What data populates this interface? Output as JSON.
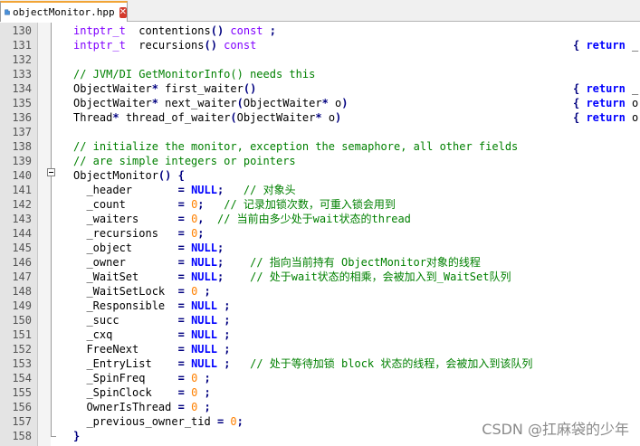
{
  "tab": {
    "title": "objectMonitor.hpp",
    "close": "✕"
  },
  "watermark": "CSDN @扛麻袋的少年",
  "lines": [
    {
      "n": "130",
      "code": [
        [
          "ty",
          "intptr_t"
        ],
        [
          "",
          "  contentions"
        ],
        [
          "op",
          "()"
        ],
        [
          "",
          ""
        ],
        [
          "kw",
          " const"
        ],
        [
          "",
          " "
        ],
        [
          "op",
          ";"
        ]
      ],
      "right": []
    },
    {
      "n": "131",
      "code": [
        [
          "ty",
          "intptr_t"
        ],
        [
          "",
          "  recursions"
        ],
        [
          "op",
          "()"
        ],
        [
          "kw",
          " const"
        ]
      ],
      "right": [
        [
          "op",
          "{"
        ],
        [
          "kb",
          " return"
        ],
        [
          "",
          " _"
        ]
      ]
    },
    {
      "n": "132",
      "code": [],
      "right": []
    },
    {
      "n": "133",
      "code": [
        [
          "cm",
          "// JVM/DI GetMonitorInfo() needs this"
        ]
      ],
      "right": []
    },
    {
      "n": "134",
      "code": [
        [
          "",
          "ObjectWaiter"
        ],
        [
          "op",
          "*"
        ],
        [
          "",
          " first_waiter"
        ],
        [
          "op",
          "()"
        ]
      ],
      "right": [
        [
          "op",
          "{"
        ],
        [
          "kb",
          " return"
        ],
        [
          "",
          " _"
        ]
      ]
    },
    {
      "n": "135",
      "code": [
        [
          "",
          "ObjectWaiter"
        ],
        [
          "op",
          "*"
        ],
        [
          "",
          " next_waiter"
        ],
        [
          "op",
          "("
        ],
        [
          "",
          "ObjectWaiter"
        ],
        [
          "op",
          "*"
        ],
        [
          "",
          " o"
        ],
        [
          "op",
          ")"
        ]
      ],
      "right": [
        [
          "op",
          "{"
        ],
        [
          "kb",
          " return"
        ],
        [
          "",
          " o"
        ]
      ]
    },
    {
      "n": "136",
      "code": [
        [
          "",
          "Thread"
        ],
        [
          "op",
          "*"
        ],
        [
          "",
          " thread_of_waiter"
        ],
        [
          "op",
          "("
        ],
        [
          "",
          "ObjectWaiter"
        ],
        [
          "op",
          "*"
        ],
        [
          "",
          " o"
        ],
        [
          "op",
          ")"
        ]
      ],
      "right": [
        [
          "op",
          "{"
        ],
        [
          "kb",
          " return"
        ],
        [
          "",
          " o"
        ]
      ]
    },
    {
      "n": "137",
      "code": [],
      "right": []
    },
    {
      "n": "138",
      "code": [
        [
          "cm",
          "// initialize the monitor, exception the semaphore, all other fields"
        ]
      ],
      "right": []
    },
    {
      "n": "139",
      "code": [
        [
          "cm",
          "// are simple integers or pointers"
        ]
      ],
      "right": []
    },
    {
      "n": "140",
      "code": [
        [
          "",
          "ObjectMonitor"
        ],
        [
          "op",
          "()"
        ],
        [
          "",
          " "
        ],
        [
          "op",
          "{"
        ]
      ],
      "right": []
    },
    {
      "n": "141",
      "code": [
        [
          "",
          "  _header       "
        ],
        [
          "op",
          "="
        ],
        [
          "",
          " "
        ],
        [
          "kb",
          "NULL"
        ],
        [
          "op",
          ";"
        ],
        [
          "",
          "   "
        ],
        [
          "cm",
          "// 对象头"
        ]
      ],
      "right": []
    },
    {
      "n": "142",
      "code": [
        [
          "",
          "  _count        "
        ],
        [
          "op",
          "="
        ],
        [
          "",
          " "
        ],
        [
          "num",
          "0"
        ],
        [
          "op",
          ";"
        ],
        [
          "",
          "   "
        ],
        [
          "cm",
          "// 记录加锁次数，可重入锁会用到"
        ]
      ],
      "right": []
    },
    {
      "n": "143",
      "code": [
        [
          "",
          "  _waiters      "
        ],
        [
          "op",
          "="
        ],
        [
          "",
          " "
        ],
        [
          "num",
          "0"
        ],
        [
          "op",
          ","
        ],
        [
          "",
          "  "
        ],
        [
          "cm",
          "// 当前由多少处于wait状态的thread"
        ]
      ],
      "right": []
    },
    {
      "n": "144",
      "code": [
        [
          "",
          "  _recursions   "
        ],
        [
          "op",
          "="
        ],
        [
          "",
          " "
        ],
        [
          "num",
          "0"
        ],
        [
          "op",
          ";"
        ]
      ],
      "right": []
    },
    {
      "n": "145",
      "code": [
        [
          "",
          "  _object       "
        ],
        [
          "op",
          "="
        ],
        [
          "",
          " "
        ],
        [
          "kb",
          "NULL"
        ],
        [
          "op",
          ";"
        ]
      ],
      "right": []
    },
    {
      "n": "146",
      "code": [
        [
          "",
          "  _owner        "
        ],
        [
          "op",
          "="
        ],
        [
          "",
          " "
        ],
        [
          "kb",
          "NULL"
        ],
        [
          "op",
          ";"
        ],
        [
          "",
          "    "
        ],
        [
          "cm",
          "// 指向当前持有 ObjectMonitor对象的线程"
        ]
      ],
      "right": []
    },
    {
      "n": "147",
      "code": [
        [
          "",
          "  _WaitSet      "
        ],
        [
          "op",
          "="
        ],
        [
          "",
          " "
        ],
        [
          "kb",
          "NULL"
        ],
        [
          "op",
          ";"
        ],
        [
          "",
          "    "
        ],
        [
          "cm",
          "// 处于wait状态的相乘，会被加入到_WaitSet队列"
        ]
      ],
      "right": []
    },
    {
      "n": "148",
      "code": [
        [
          "",
          "  _WaitSetLock  "
        ],
        [
          "op",
          "="
        ],
        [
          "",
          " "
        ],
        [
          "num",
          "0"
        ],
        [
          "",
          " "
        ],
        [
          "op",
          ";"
        ]
      ],
      "right": []
    },
    {
      "n": "149",
      "code": [
        [
          "",
          "  _Responsible  "
        ],
        [
          "op",
          "="
        ],
        [
          "",
          " "
        ],
        [
          "kb",
          "NULL"
        ],
        [
          "",
          " "
        ],
        [
          "op",
          ";"
        ]
      ],
      "right": []
    },
    {
      "n": "150",
      "code": [
        [
          "",
          "  _succ         "
        ],
        [
          "op",
          "="
        ],
        [
          "",
          " "
        ],
        [
          "kb",
          "NULL"
        ],
        [
          "",
          " "
        ],
        [
          "op",
          ";"
        ]
      ],
      "right": []
    },
    {
      "n": "151",
      "code": [
        [
          "",
          "  _cxq          "
        ],
        [
          "op",
          "="
        ],
        [
          "",
          " "
        ],
        [
          "kb",
          "NULL"
        ],
        [
          "",
          " "
        ],
        [
          "op",
          ";"
        ]
      ],
      "right": []
    },
    {
      "n": "152",
      "code": [
        [
          "",
          "  FreeNext      "
        ],
        [
          "op",
          "="
        ],
        [
          "",
          " "
        ],
        [
          "kb",
          "NULL"
        ],
        [
          "",
          " "
        ],
        [
          "op",
          ";"
        ]
      ],
      "right": []
    },
    {
      "n": "153",
      "code": [
        [
          "",
          "  _EntryList    "
        ],
        [
          "op",
          "="
        ],
        [
          "",
          " "
        ],
        [
          "kb",
          "NULL"
        ],
        [
          "",
          " "
        ],
        [
          "op",
          ";"
        ],
        [
          "",
          "   "
        ],
        [
          "cm",
          "// 处于等待加锁 block 状态的线程，会被加入到该队列"
        ]
      ],
      "right": []
    },
    {
      "n": "154",
      "code": [
        [
          "",
          "  _SpinFreq     "
        ],
        [
          "op",
          "="
        ],
        [
          "",
          " "
        ],
        [
          "num",
          "0"
        ],
        [
          "",
          " "
        ],
        [
          "op",
          ";"
        ]
      ],
      "right": []
    },
    {
      "n": "155",
      "code": [
        [
          "",
          "  _SpinClock    "
        ],
        [
          "op",
          "="
        ],
        [
          "",
          " "
        ],
        [
          "num",
          "0"
        ],
        [
          "",
          " "
        ],
        [
          "op",
          ";"
        ]
      ],
      "right": []
    },
    {
      "n": "156",
      "code": [
        [
          "",
          "  OwnerIsThread "
        ],
        [
          "op",
          "="
        ],
        [
          "",
          " "
        ],
        [
          "num",
          "0"
        ],
        [
          "",
          " "
        ],
        [
          "op",
          ";"
        ]
      ],
      "right": []
    },
    {
      "n": "157",
      "code": [
        [
          "",
          "  _previous_owner_tid "
        ],
        [
          "op",
          "="
        ],
        [
          "",
          " "
        ],
        [
          "num",
          "0"
        ],
        [
          "op",
          ";"
        ]
      ],
      "right": []
    },
    {
      "n": "158",
      "code": [
        [
          "op",
          "}"
        ]
      ],
      "right": []
    }
  ]
}
